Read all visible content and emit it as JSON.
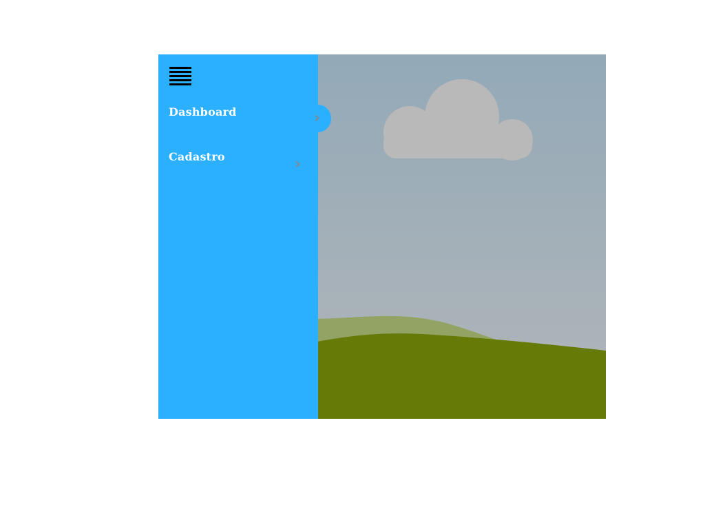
{
  "sidebar": {
    "items": [
      {
        "label": "Dashboard",
        "chevron": "›"
      },
      {
        "label": "Cadastro",
        "chevron": "›"
      }
    ],
    "menu_icon": "hamburger-menu-icon",
    "expand_icon": "chevron-right-icon",
    "color": "#2bb0ff"
  },
  "main": {
    "background_image": "landscape-placeholder-image"
  }
}
